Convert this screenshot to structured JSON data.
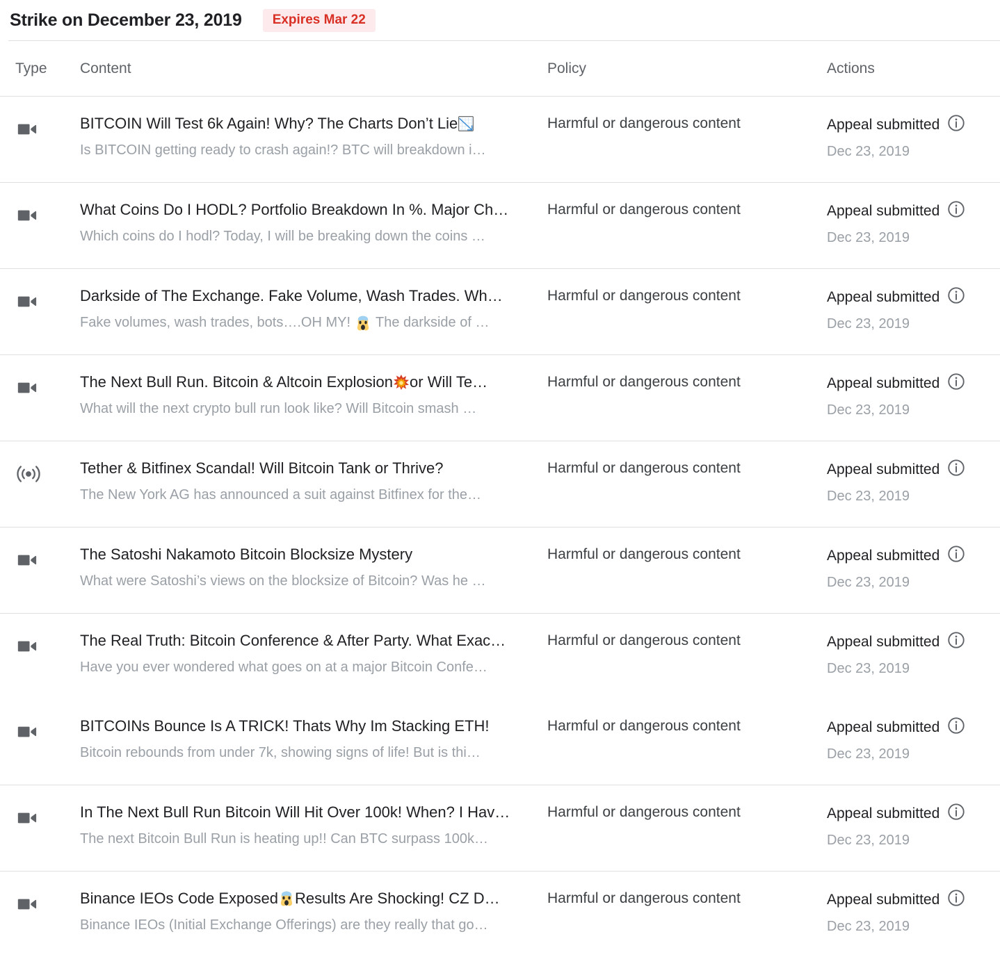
{
  "header": {
    "title": "Strike on December 23, 2019",
    "expiry_badge": "Expires Mar 22",
    "badge_bg": "#fdeaed",
    "badge_color": "#d93025"
  },
  "table": {
    "columns": {
      "type": "Type",
      "content": "Content",
      "policy": "Policy",
      "actions": "Actions"
    },
    "rows": [
      {
        "type_icon": "video-camera-icon",
        "title": "BITCOIN Will Test 6k Again! Why? The Charts Don’t Lie",
        "title_emoji": "chart-decreasing",
        "description": "Is BITCOIN getting ready to crash again!? BTC will breakdown i…",
        "description_emoji": "",
        "policy": "Harmful or dangerous content",
        "action_status": "Appeal submitted",
        "action_date": "Dec 23, 2019",
        "divider_after": true
      },
      {
        "type_icon": "video-camera-icon",
        "title": "What Coins Do I HODL? Portfolio Breakdown In %. Major Ch…",
        "title_emoji": "",
        "description": "Which coins do I hodl? Today, I will be breaking down the coins …",
        "description_emoji": "",
        "policy": "Harmful or dangerous content",
        "action_status": "Appeal submitted",
        "action_date": "Dec 23, 2019",
        "divider_after": true
      },
      {
        "type_icon": "video-camera-icon",
        "title": "Darkside of The Exchange. Fake Volume, Wash Trades. Wh…",
        "title_emoji": "",
        "description": "Fake volumes, wash trades, bots….OH MY!",
        "description_emoji": "face-screaming",
        "description_tail": "The darkside of …",
        "policy": "Harmful or dangerous content",
        "action_status": "Appeal submitted",
        "action_date": "Dec 23, 2019",
        "divider_after": true
      },
      {
        "type_icon": "video-camera-icon",
        "title": "The Next Bull Run. Bitcoin & Altcoin Explosion",
        "title_emoji": "collision",
        "title_tail": "or Will Te…",
        "description": "What will the next crypto bull run look like? Will Bitcoin smash …",
        "description_emoji": "",
        "policy": "Harmful or dangerous content",
        "action_status": "Appeal submitted",
        "action_date": "Dec 23, 2019",
        "divider_after": true
      },
      {
        "type_icon": "live-broadcast-icon",
        "title": "Tether & Bitfinex Scandal! Will Bitcoin Tank or Thrive?",
        "title_emoji": "",
        "description": "The New York AG has announced a suit against Bitfinex for the…",
        "description_emoji": "",
        "policy": "Harmful or dangerous content",
        "action_status": "Appeal submitted",
        "action_date": "Dec 23, 2019",
        "divider_after": true
      },
      {
        "type_icon": "video-camera-icon",
        "title": "The Satoshi Nakamoto Bitcoin Blocksize Mystery",
        "title_emoji": "",
        "description": "What were Satoshi’s views on the blocksize of Bitcoin? Was he …",
        "description_emoji": "",
        "policy": "Harmful or dangerous content",
        "action_status": "Appeal submitted",
        "action_date": "Dec 23, 2019",
        "divider_after": true
      },
      {
        "type_icon": "video-camera-icon",
        "title": "The Real Truth: Bitcoin Conference & After Party. What Exac…",
        "title_emoji": "",
        "description": "Have you ever wondered what goes on at a major Bitcoin Confe…",
        "description_emoji": "",
        "policy": "Harmful or dangerous content",
        "action_status": "Appeal submitted",
        "action_date": "Dec 23, 2019",
        "divider_after": false
      },
      {
        "type_icon": "video-camera-icon",
        "title": "BITCOINs Bounce Is A TRICK! Thats Why Im Stacking ETH!",
        "title_emoji": "",
        "description": "Bitcoin rebounds from under 7k, showing signs of life! But is thi…",
        "description_emoji": "",
        "policy": "Harmful or dangerous content",
        "action_status": "Appeal submitted",
        "action_date": "Dec 23, 2019",
        "divider_after": true
      },
      {
        "type_icon": "video-camera-icon",
        "title": "In The Next Bull Run Bitcoin Will Hit Over 100k! When? I Hav…",
        "title_emoji": "",
        "description": "The next Bitcoin Bull Run is heating up!! Can BTC surpass 100k…",
        "description_emoji": "",
        "policy": "Harmful or dangerous content",
        "action_status": "Appeal submitted",
        "action_date": "Dec 23, 2019",
        "divider_after": true
      },
      {
        "type_icon": "video-camera-icon",
        "title": "Binance IEOs Code Exposed",
        "title_emoji": "face-screaming",
        "title_tail": "Results Are Shocking! CZ D…",
        "description": "Binance IEOs (Initial Exchange Offerings) are they really that go…",
        "description_emoji": "",
        "policy": "Harmful or dangerous content",
        "action_status": "Appeal submitted",
        "action_date": "Dec 23, 2019",
        "divider_after": false
      }
    ]
  }
}
